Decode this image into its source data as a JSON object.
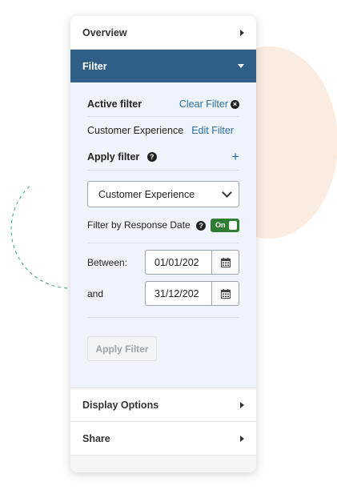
{
  "panel": {
    "overview": {
      "label": "Overview",
      "icon": "caret-right-icon"
    },
    "filter": {
      "label": "Filter",
      "icon": "caret-down-icon",
      "active_filter_label": "Active filter",
      "clear_filter_label": "Clear Filter",
      "current_filter_name": "Customer Experience",
      "edit_filter_label": "Edit Filter",
      "apply_filter_heading": "Apply filter",
      "add_icon": "+",
      "select_value": "Customer Experience",
      "response_date_label": "Filter by Response Date",
      "toggle_label": "On",
      "toggle_state": true,
      "between_label": "Between:",
      "and_label": "and",
      "start_date": "01/01/202",
      "end_date": "31/12/202",
      "apply_button_label": "Apply Filter"
    },
    "display_options": {
      "label": "Display Options",
      "icon": "caret-right-icon"
    },
    "share": {
      "label": "Share",
      "icon": "caret-right-icon"
    }
  },
  "colors": {
    "header_blue": "#2f5f86",
    "link_blue": "#2a6ea5",
    "toggle_green": "#2e7d32",
    "body_bg": "#eef4f9",
    "deco_peach": "#fbece2",
    "deco_dash": "#3aa57a"
  }
}
